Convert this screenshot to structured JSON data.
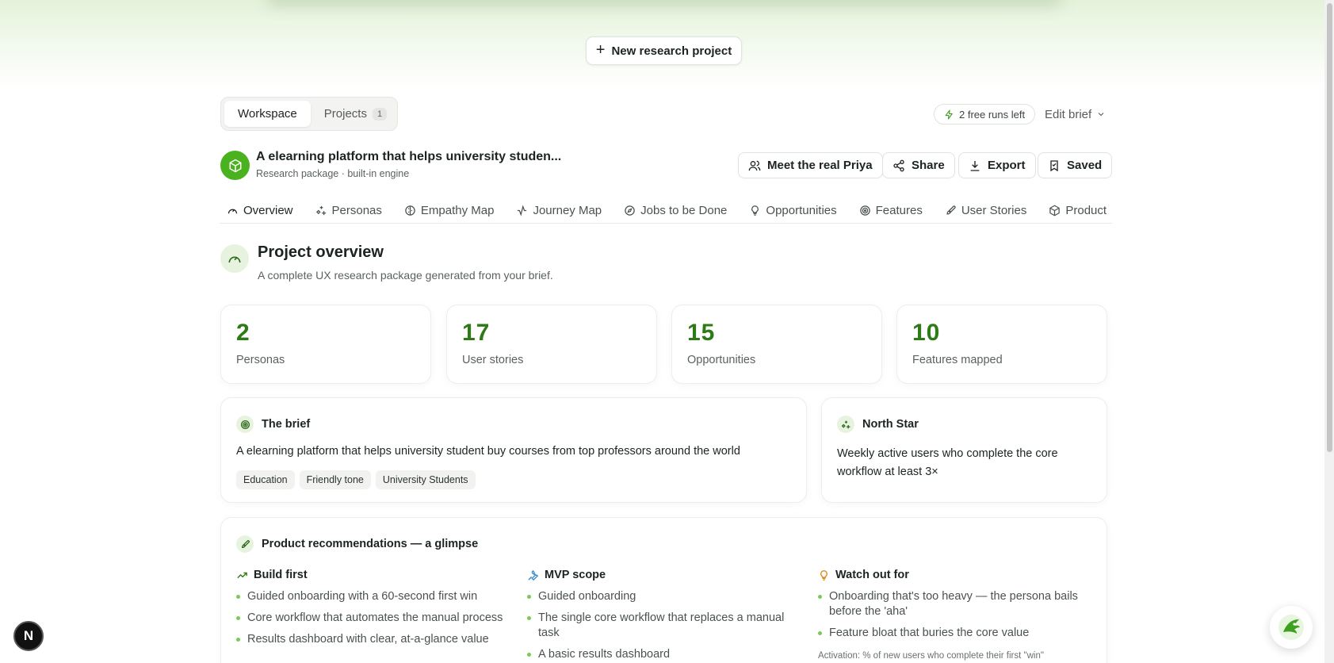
{
  "top": {
    "new_project_label": "New research project"
  },
  "switcher": {
    "workspace_label": "Workspace",
    "projects_label": "Projects",
    "projects_count": "1"
  },
  "runs": {
    "label": "2 free runs left"
  },
  "edit_brief": {
    "label": "Edit brief"
  },
  "project": {
    "title": "A elearning platform that helps university studen...",
    "subtitle": "Research package · built-in engine"
  },
  "header_actions": {
    "meet_label": "Meet the real Priya",
    "share_label": "Share",
    "export_label": "Export",
    "saved_label": "Saved"
  },
  "nav": {
    "tabs": [
      {
        "label": "Overview",
        "icon": "gauge-icon"
      },
      {
        "label": "Personas",
        "icon": "sparkles-icon"
      },
      {
        "label": "Empathy Map",
        "icon": "brain-icon"
      },
      {
        "label": "Journey Map",
        "icon": "activity-icon"
      },
      {
        "label": "Jobs to be Done",
        "icon": "compass-icon"
      },
      {
        "label": "Opportunities",
        "icon": "lightbulb-icon"
      },
      {
        "label": "Features",
        "icon": "target-icon"
      },
      {
        "label": "User Stories",
        "icon": "rocket-icon"
      },
      {
        "label": "Product",
        "icon": "package-icon"
      }
    ]
  },
  "overview": {
    "title": "Project overview",
    "description": "A complete UX research package generated from your brief."
  },
  "stats": [
    {
      "value": "2",
      "label": "Personas"
    },
    {
      "value": "17",
      "label": "User stories"
    },
    {
      "value": "15",
      "label": "Opportunities"
    },
    {
      "value": "10",
      "label": "Features mapped"
    }
  ],
  "brief": {
    "heading": "The brief",
    "text": "A elearning platform that helps university student buy courses from top professors around the world",
    "tags": [
      "Education",
      "Friendly tone",
      "University Students"
    ]
  },
  "north_star": {
    "heading": "North Star",
    "text": "Weekly active users who complete the core workflow at least 3×"
  },
  "recommendations": {
    "heading": "Product recommendations — a glimpse",
    "build_first": {
      "heading": "Build first",
      "items": [
        "Guided onboarding with a 60-second first win",
        "Core workflow that automates the manual process",
        "Results dashboard with clear, at-a-glance value"
      ]
    },
    "mvp_scope": {
      "heading": "MVP scope",
      "items": [
        "Guided onboarding",
        "The single core workflow that replaces a manual task",
        "A basic results dashboard"
      ]
    },
    "watch_out": {
      "heading": "Watch out for",
      "items": [
        "Onboarding that's too heavy — the persona bails before the 'aha'",
        "Feature bloat that buries the core value"
      ],
      "metric": "Activation: % of new users who complete their first \"win\""
    }
  },
  "badge": {
    "letter": "N"
  },
  "colors": {
    "accent": "#3f9f1f",
    "stat_number": "#2e7a17",
    "project_icon_bg": "#4ab21f"
  }
}
